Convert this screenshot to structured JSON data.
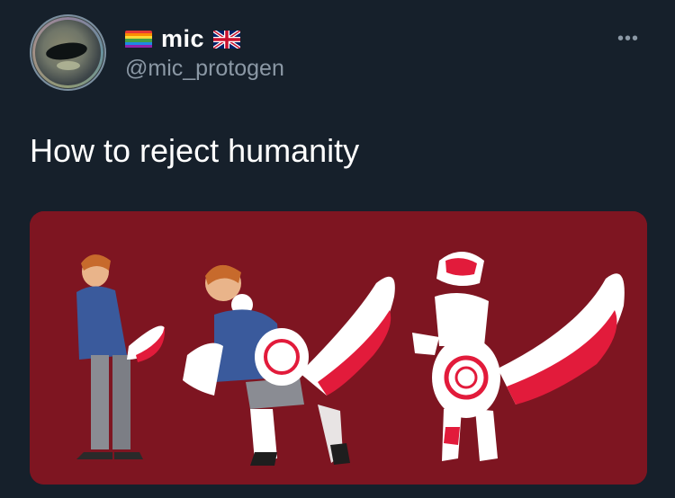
{
  "tweet": {
    "display_name": "mic",
    "handle": "@mic_protogen",
    "text": "How to reject humanity",
    "more_label": "•••",
    "name_flag_left": "rainbow-flag-icon",
    "name_flag_right": "uk-flag-icon"
  },
  "colors": {
    "background": "#16202b",
    "media_background": "#7e1521",
    "accent_red": "#e21b3b"
  }
}
